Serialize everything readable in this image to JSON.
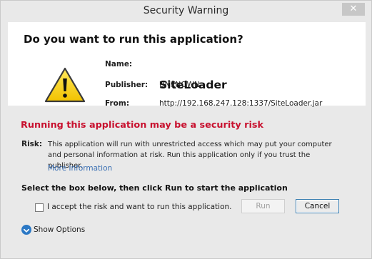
{
  "window": {
    "title": "Security Warning",
    "close_glyph": "✕"
  },
  "dialog": {
    "question": "Do you want to run this application?",
    "icon": "warning-triangle-icon",
    "fields": {
      "name_label": "Name:",
      "name_value": "SiteLoader",
      "publisher_label": "Publisher:",
      "publisher_value": "UNKNOWN",
      "from_label": "From:",
      "from_value": "http://192.168.247.128:1337/SiteLoader.jar"
    }
  },
  "risk": {
    "heading": "Running this application may be a security risk",
    "heading_color": "#c8102e",
    "label": "Risk:",
    "text": "This application will run with unrestricted access which may put your computer and personal information at risk. Run this application only if you trust the publisher.",
    "more_info_link": "More Information"
  },
  "accept": {
    "instruction": "Select the box below, then click Run to start the application",
    "checkbox_label": "I accept the risk and want to run this application.",
    "checked": false
  },
  "buttons": {
    "run_label": "Run",
    "cancel_label": "Cancel"
  },
  "options": {
    "show_options_label": "Show Options",
    "icon": "chevron-down-circle-icon"
  }
}
